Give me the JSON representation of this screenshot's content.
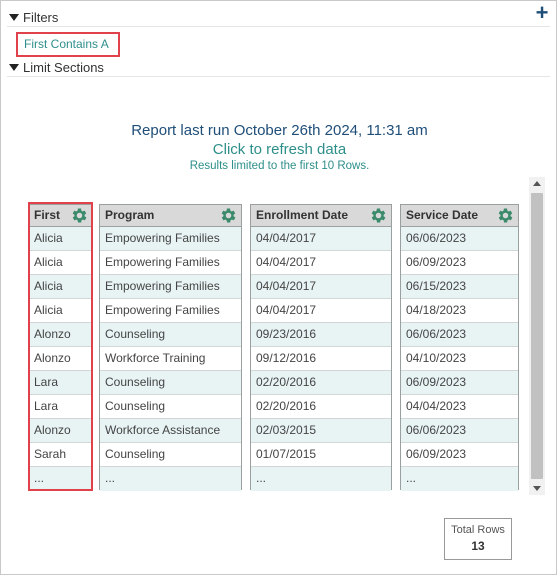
{
  "filters": {
    "header_label": "Filters",
    "add_icon": "plus-icon",
    "active_filter": "First Contains A"
  },
  "limit_sections": {
    "header_label": "Limit Sections"
  },
  "report": {
    "last_run": "Report last run October 26th 2024, 11:31 am",
    "refresh_link": "Click to refresh data",
    "limit_note": "Results limited to the first 10 Rows."
  },
  "columns": [
    {
      "header": "First",
      "values": [
        "Alicia",
        "Alicia",
        "Alicia",
        "Alicia",
        "Alonzo",
        "Alonzo",
        "Lara",
        "Lara",
        "Alonzo",
        "Sarah",
        "..."
      ]
    },
    {
      "header": "Program",
      "values": [
        "Empowering Families",
        "Empowering Families",
        "Empowering Families",
        "Empowering Families",
        "Counseling",
        "Workforce Training",
        "Counseling",
        "Counseling",
        "Workforce Assistance",
        "Counseling",
        "..."
      ]
    },
    {
      "header": "Enrollment Date",
      "values": [
        "04/04/2017",
        "04/04/2017",
        "04/04/2017",
        "04/04/2017",
        "09/23/2016",
        "09/12/2016",
        "02/20/2016",
        "02/20/2016",
        "02/03/2015",
        "01/07/2015",
        "..."
      ]
    },
    {
      "header": "Service Date",
      "values": [
        "06/06/2023",
        "06/09/2023",
        "06/15/2023",
        "04/18/2023",
        "06/06/2023",
        "04/10/2023",
        "06/09/2023",
        "04/04/2023",
        "06/06/2023",
        "06/09/2023",
        "..."
      ]
    }
  ],
  "totals": {
    "label": "Total Rows",
    "value": "13"
  },
  "colors": {
    "accent_teal": "#2e8f8a",
    "title_blue": "#1f4e79",
    "gear_green": "#3a8a6b",
    "highlight_red": "#e0414a",
    "row_alt": "#e8f4f3",
    "header_gray": "#d9d9d9"
  }
}
